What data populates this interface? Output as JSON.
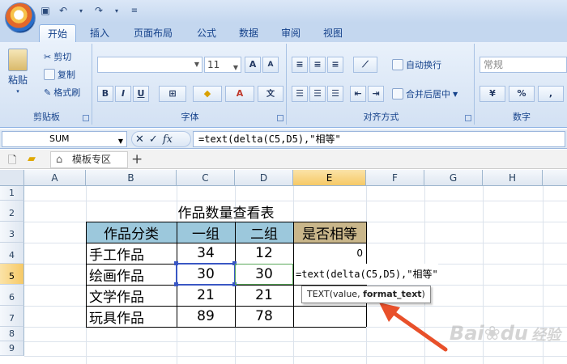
{
  "quick_access": {
    "save_icon": "save-icon",
    "undo_icon": "undo-icon",
    "redo_icon": "redo-icon"
  },
  "tabs": [
    "开始",
    "插入",
    "页面布局",
    "公式",
    "数据",
    "审阅",
    "视图"
  ],
  "active_tab": "开始",
  "ribbon": {
    "clipboard": {
      "paste": "粘贴",
      "cut": "剪切",
      "copy": "复制",
      "format_painter": "格式刷",
      "label": "剪贴板"
    },
    "font": {
      "font_size": "11",
      "bold": "B",
      "italic": "I",
      "underline": "U",
      "grow": "A",
      "shrink": "A",
      "label": "字体"
    },
    "alignment": {
      "wrap_text": "自动换行",
      "merge_center": "合并后居中",
      "label": "对齐方式"
    },
    "number": {
      "format": "常规",
      "percent": "%",
      "comma": ",",
      "label": "数字"
    }
  },
  "formula_bar": {
    "name_box": "SUM",
    "formula": "=text(delta(C5,D5),\"相等\""
  },
  "doc_tabs": {
    "tab_label": "模板专区"
  },
  "columns": [
    "A",
    "B",
    "C",
    "D",
    "E",
    "F",
    "G",
    "H"
  ],
  "rows": [
    "1",
    "2",
    "3",
    "4",
    "5",
    "6",
    "7",
    "8",
    "9"
  ],
  "sheet": {
    "title": "作品数量查看表",
    "headers": [
      "作品分类",
      "一组",
      "二组",
      "是否相等"
    ],
    "data": [
      [
        "手工作品",
        "34",
        "12",
        "0"
      ],
      [
        "绘画作品",
        "30",
        "30",
        ""
      ],
      [
        "文学作品",
        "21",
        "21",
        ""
      ],
      [
        "玩具作品",
        "89",
        "78",
        ""
      ]
    ],
    "edit_text": "=text(delta(C5,D5),\"相等\"",
    "tooltip_prefix": "TEXT(value, ",
    "tooltip_bold": "format_text",
    "tooltip_suffix": ")"
  },
  "colors": {
    "header_blue": "#9cc8dc",
    "header_tan": "#c9b68a",
    "selection": "#3a57c4",
    "arrow": "#e8502a"
  },
  "watermark": {
    "brand": "Bai",
    "paw": "du",
    "suffix": "经验"
  }
}
